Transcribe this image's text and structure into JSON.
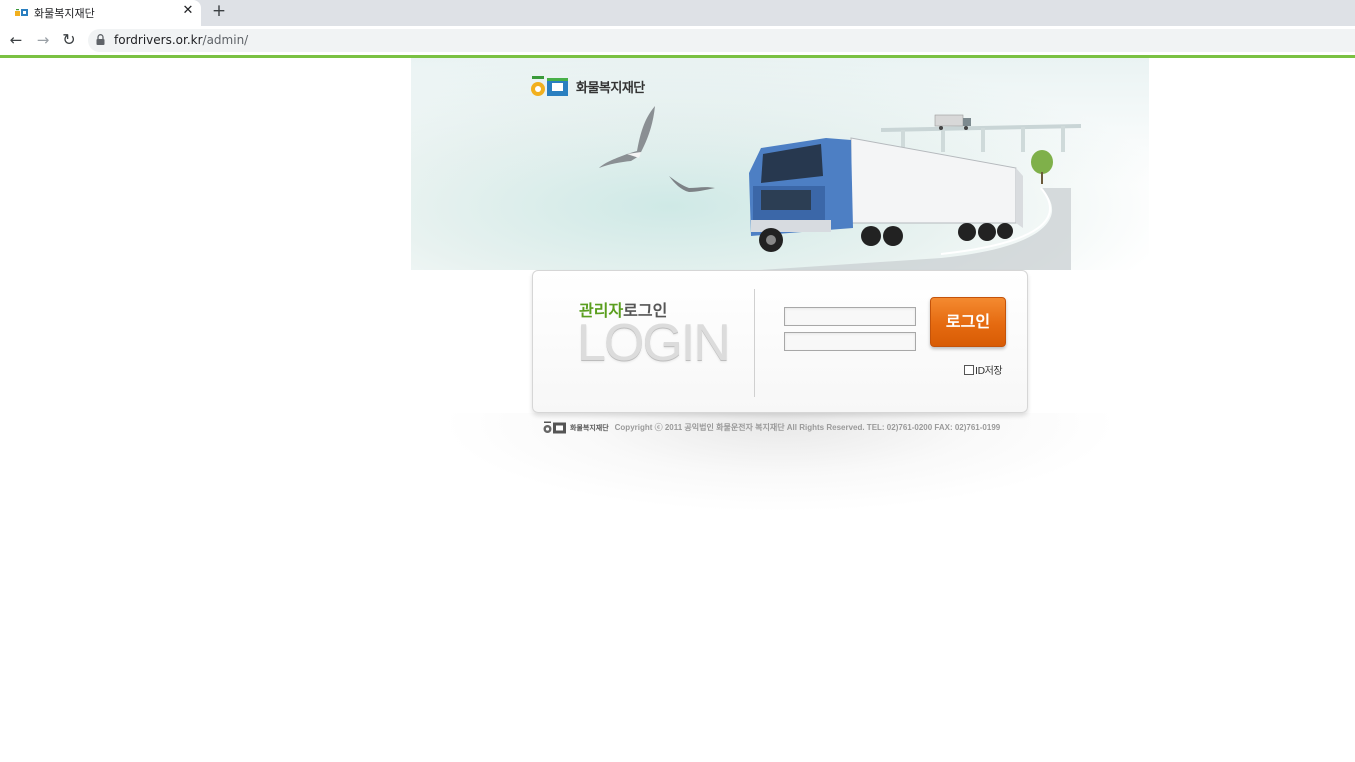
{
  "browser": {
    "tab_title": "화물복지재단",
    "tab_close": "✕",
    "new_tab": "+",
    "nav_back": "←",
    "nav_forward": "→",
    "nav_reload": "↻",
    "url_host": "fordrivers.or.kr",
    "url_path": "/admin/",
    "accent_color": "#7ac142"
  },
  "header": {
    "logo_text": "화물복지재단"
  },
  "login": {
    "title_green": "관리자",
    "title_gray": "로그인",
    "big_text": "LOGIN",
    "id_value": "",
    "pw_value": "",
    "button_label": "로그인",
    "save_id_label": "ID저장",
    "save_id_checked": false,
    "button_color": "#e56a10"
  },
  "footer": {
    "org": "화물복지재단",
    "copyright": "Copyright ⓒ 2011 공익법인 화물운전자 복지재단  All Rights Reserved. TEL: 02)761-0200   FAX: 02)761-0199"
  },
  "icons": [
    "lock-icon",
    "back-arrow-icon",
    "forward-arrow-icon",
    "reload-icon",
    "close-icon",
    "plus-icon",
    "foundation-logo-icon"
  ]
}
